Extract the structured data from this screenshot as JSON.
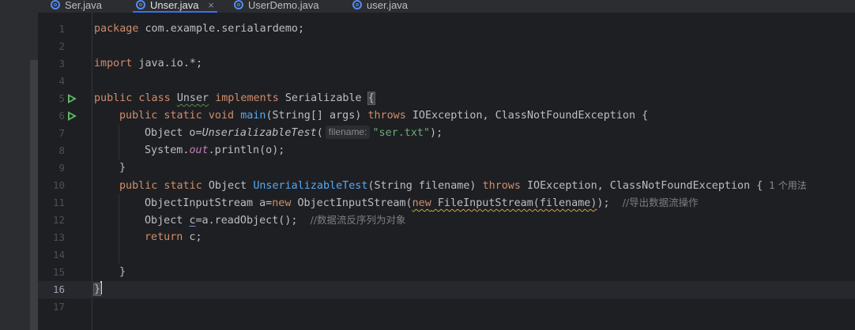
{
  "tabs": [
    {
      "label": "Ser.java",
      "active": false
    },
    {
      "label": "Unser.java",
      "active": true,
      "close": "×"
    },
    {
      "label": "UserDemo.java",
      "active": false
    },
    {
      "label": "user.java",
      "active": false
    }
  ],
  "code": {
    "line_numbers": [
      "1",
      "2",
      "3",
      "4",
      "5",
      "6",
      "7",
      "8",
      "9",
      "10",
      "11",
      "12",
      "13",
      "14",
      "15",
      "16",
      "17"
    ],
    "l1": {
      "kw": "package",
      "rest": " com.example.serialardemo;"
    },
    "l3": {
      "kw": "import",
      "rest": " java.io.*;"
    },
    "l5": {
      "kw1": "public class",
      "cls": "Unser",
      "kw2": "implements",
      "iface": "Serializable",
      "brace": "{"
    },
    "l6": {
      "kw": "public static void",
      "fn": "main",
      "args": "(String[] args)",
      "kw2": "throws",
      "rest": "IOException, ClassNotFoundException {"
    },
    "l7": {
      "pre": "Object o=",
      "call": "UnserializableTest",
      "open": "(",
      "hint": "filename:",
      "str": "\"ser.txt\"",
      "post": ");"
    },
    "l8": {
      "pre": "System.",
      "field": "out",
      "post": ".println(o);"
    },
    "l9": {
      "text": "}"
    },
    "l10": {
      "kw": "public static",
      "type": " Object ",
      "fn": "UnserializableTest",
      "args": "(String filename)",
      "kw2": "throws",
      "rest": "IOException, ClassNotFoundException {",
      "usage": "1 个用法"
    },
    "l11": {
      "pre": "ObjectInputStream a=",
      "kw": "new",
      "mid": " ObjectInputStream(",
      "kw2": "new",
      "inner": " FileInputStream(filename)",
      "post": ");",
      "comment": "//导出数据流操作"
    },
    "l12": {
      "pre": "Object ",
      "var": "c",
      "post": "=a.readObject();",
      "comment": "//数据流反序列为对象"
    },
    "l13": {
      "kw": "return",
      "rest": " c;"
    },
    "l15": {
      "text": "}"
    },
    "l16": {
      "text": "}"
    }
  },
  "colors": {
    "keyword": "#cf8e6d",
    "function": "#56a8f5",
    "string": "#6aab73",
    "static_field": "#c77dbb",
    "comment": "#7a7e85",
    "run_icon": "#5fb865"
  },
  "icons": {
    "tab_file": "java-class-icon",
    "gutter_run": "run-icon"
  }
}
